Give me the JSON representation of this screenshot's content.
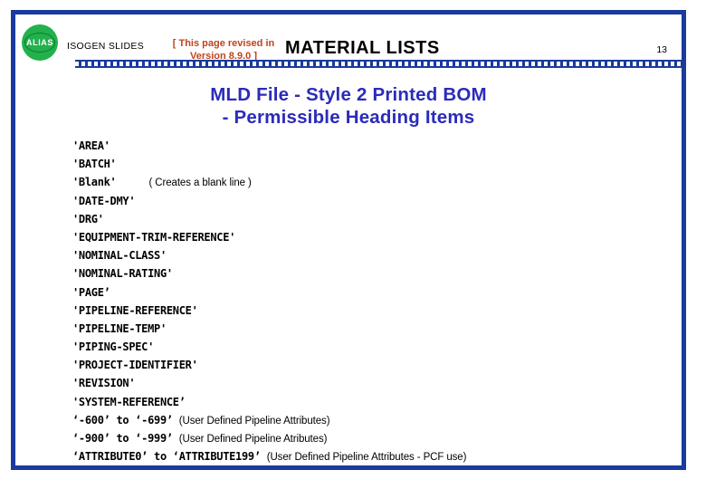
{
  "theme": {
    "frame_blue": "#1a3a9e",
    "title_blue": "#2b2bbb",
    "revision_red": "#c0441b",
    "logo_green": "#22b14c"
  },
  "header": {
    "logo_text": "ALIAS",
    "brand": "ISOGEN SLIDES",
    "revision_line1": "[ This page revised in",
    "revision_line2": "Version 8.9.0 ]",
    "section_title": "MATERIAL LISTS",
    "page_number": "13"
  },
  "title": {
    "line1": "MLD File - Style 2 Printed BOM",
    "line2": "- Permissible Heading Items"
  },
  "items": [
    {
      "keyword": "'AREA'",
      "note": ""
    },
    {
      "keyword": "'BATCH'",
      "note": ""
    },
    {
      "keyword": "'Blank'",
      "note": "(  Creates a blank line  )"
    },
    {
      "keyword": "'DATE-DMY'",
      "note": ""
    },
    {
      "keyword": "'DRG'",
      "note": ""
    },
    {
      "keyword": "'EQUIPMENT-TRIM-REFERENCE'",
      "note": ""
    },
    {
      "keyword": "'NOMINAL-CLASS'",
      "note": ""
    },
    {
      "keyword": "'NOMINAL-RATING'",
      "note": ""
    },
    {
      "keyword": "'PAGE’",
      "note": ""
    },
    {
      "keyword": "'PIPELINE-REFERENCE'",
      "note": ""
    },
    {
      "keyword": "'PIPELINE-TEMP'",
      "note": ""
    },
    {
      "keyword": "'PIPING-SPEC'",
      "note": ""
    },
    {
      "keyword": "'PROJECT-IDENTIFIER'",
      "note": ""
    },
    {
      "keyword": "'REVISION'",
      "note": ""
    },
    {
      "keyword": "'SYSTEM-REFERENCE’",
      "note": ""
    },
    {
      "keyword": "‘-600’ to ‘-699’",
      "note": "(User Defined Pipeline Attributes)"
    },
    {
      "keyword": "‘-900’ to ‘-999’",
      "note": "(User Defined Pipeline Atributes)"
    },
    {
      "keyword": "‘ATTRIBUTE0’ to ‘ATTRIBUTE199’",
      "note": "(User Defined Pipeline Attributes - PCF use)"
    }
  ]
}
